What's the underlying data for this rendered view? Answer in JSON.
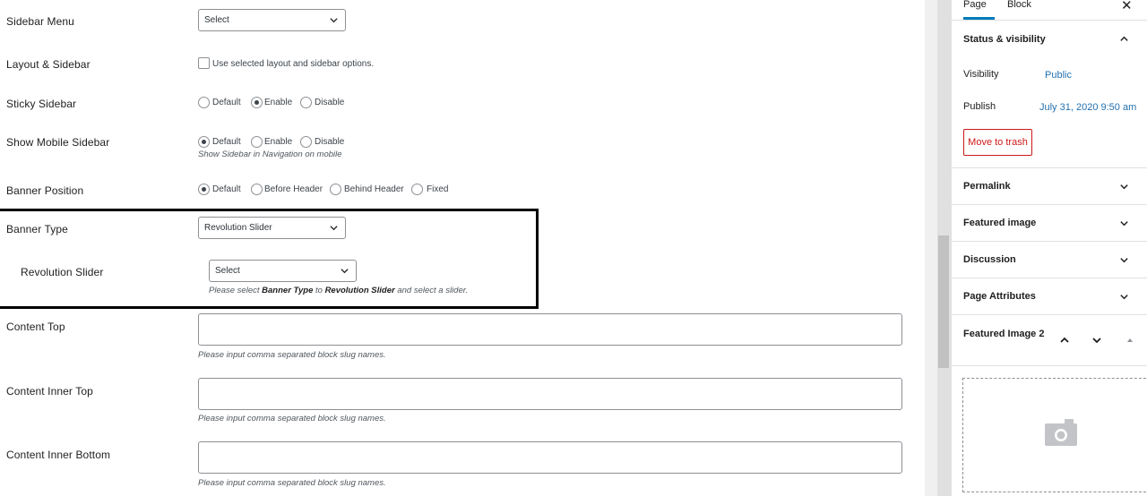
{
  "form": {
    "sidebar_menu": {
      "label": "Sidebar Menu",
      "select_value": "Select"
    },
    "layout_sidebar": {
      "label": "Layout & Sidebar",
      "checkbox_text": "Use selected layout and sidebar options.",
      "checked": false
    },
    "sticky_sidebar": {
      "label": "Sticky Sidebar",
      "options": [
        "Default",
        "Enable",
        "Disable"
      ],
      "selected": "Enable"
    },
    "show_mobile_sidebar": {
      "label": "Show Mobile Sidebar",
      "options": [
        "Default",
        "Enable",
        "Disable"
      ],
      "selected": "Default",
      "help": "Show Sidebar in Navigation on mobile"
    },
    "banner_position": {
      "label": "Banner Position",
      "options": [
        "Default",
        "Before Header",
        "Behind Header",
        "Fixed"
      ],
      "selected": "Default"
    },
    "banner_type": {
      "label": "Banner Type",
      "select_value": "Revolution Slider"
    },
    "revolution_slider": {
      "label": "Revolution Slider",
      "select_value": "Select",
      "help_prefix": "Please select ",
      "help_bold1": "Banner Type",
      "help_mid": " to ",
      "help_bold2": "Revolution Slider",
      "help_suffix": " and select a slider."
    },
    "content_top": {
      "label": "Content Top",
      "value": "",
      "help": "Please input comma separated block slug names."
    },
    "content_inner_top": {
      "label": "Content Inner Top",
      "value": "",
      "help": "Please input comma separated block slug names."
    },
    "content_inner_bottom": {
      "label": "Content Inner Bottom",
      "value": "",
      "help": "Please input comma separated block slug names."
    }
  },
  "sidebar": {
    "tabs": [
      "Page",
      "Block"
    ],
    "active_tab": "Page",
    "close_icon": "close-icon",
    "status_visibility": {
      "title": "Status & visibility",
      "visibility_label": "Visibility",
      "visibility_value": "Public",
      "publish_label": "Publish",
      "publish_value": "July 31, 2020 9:50 am",
      "trash_label": "Move to trash"
    },
    "panels": [
      "Permalink",
      "Featured image",
      "Discussion",
      "Page Attributes"
    ],
    "featured_image_2": {
      "title": "Featured Image 2"
    }
  },
  "colors": {
    "accent": "#007cba",
    "link": "#2271b1",
    "danger": "#cc1818",
    "highlight_border": "#000000"
  }
}
